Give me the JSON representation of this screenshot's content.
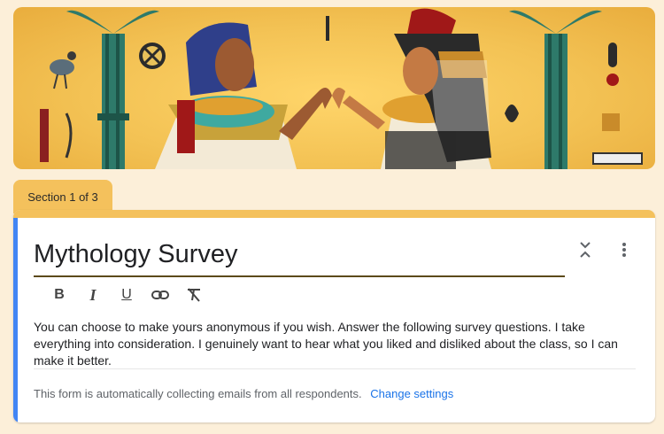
{
  "header": {
    "image_alt": "Egyptian pharaoh and queen illustration"
  },
  "section_tab": {
    "label": "Section 1 of 3"
  },
  "form": {
    "title": "Mythology Survey",
    "description": "You can choose to make yours anonymous if you wish. Answer the following survey questions.  I take everything into consideration.  I genuinely want to hear what you liked and disliked about the class, so I can make it better.",
    "email_notice": "This form is automatically collecting emails from all respondents.",
    "change_settings_label": "Change settings"
  },
  "toolbar": {
    "bold_label": "B",
    "italic_label": "I",
    "underline_label": "U"
  },
  "colors": {
    "accent": "#f4c15c",
    "page_bg": "#fcefd9",
    "link": "#1a73e8",
    "left_indicator": "#4285f4"
  }
}
